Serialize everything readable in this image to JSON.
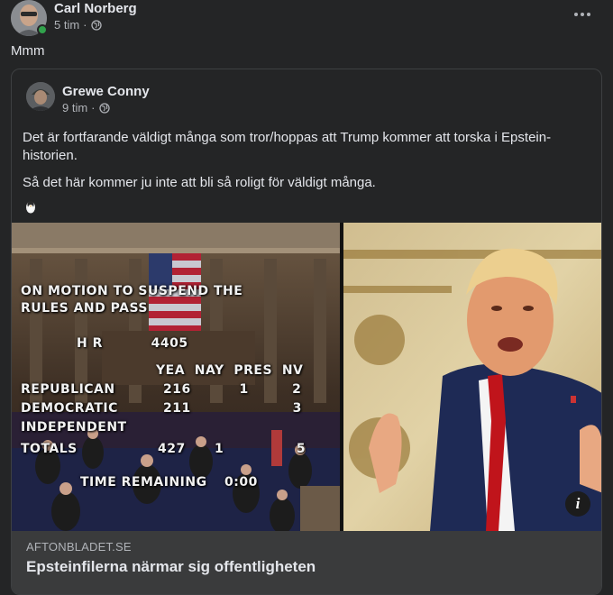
{
  "post": {
    "author": "Carl Norberg",
    "time": "5 tim",
    "separator": "·",
    "audience_icon": "globe-icon",
    "text": "Mmm"
  },
  "shared_post": {
    "author": "Grewe Conny",
    "time": "9 tim",
    "separator": "·",
    "audience_icon": "globe-icon",
    "paragraphs": [
      "Det är fortfarande väldigt många som tror/hoppas att Trump kommer att torska i Epstein-historien.",
      "Så det här kommer ju inte att bli så roligt för väldigt många."
    ],
    "emoji_icon": "penguin-icon"
  },
  "vote_board": {
    "title_line1": "ON MOTION TO SUSPEND THE",
    "title_line2": "RULES AND PASS",
    "bill": "H R          4405",
    "columns": "YEA  NAY  PRES  NV",
    "rows": [
      {
        "party": "REPUBLICAN",
        "values": "216          1         2"
      },
      {
        "party": "DEMOCRATIC",
        "values": "211                     3"
      },
      {
        "party": "INDEPENDENT",
        "values": ""
      },
      {
        "party": "TOTALS",
        "values": "427      1               5"
      }
    ],
    "time_label": "TIME REMAINING",
    "time_value": "0:00"
  },
  "link": {
    "domain": "AFTONBLADET.SE",
    "headline": "Epsteinfilerna närmar sig offentligheten",
    "info_label": "i"
  },
  "colors": {
    "background": "#242526",
    "card_footer": "#3a3b3c",
    "online": "#31a24c",
    "text_primary": "#e4e6eb",
    "text_secondary": "#b0b3b8"
  }
}
